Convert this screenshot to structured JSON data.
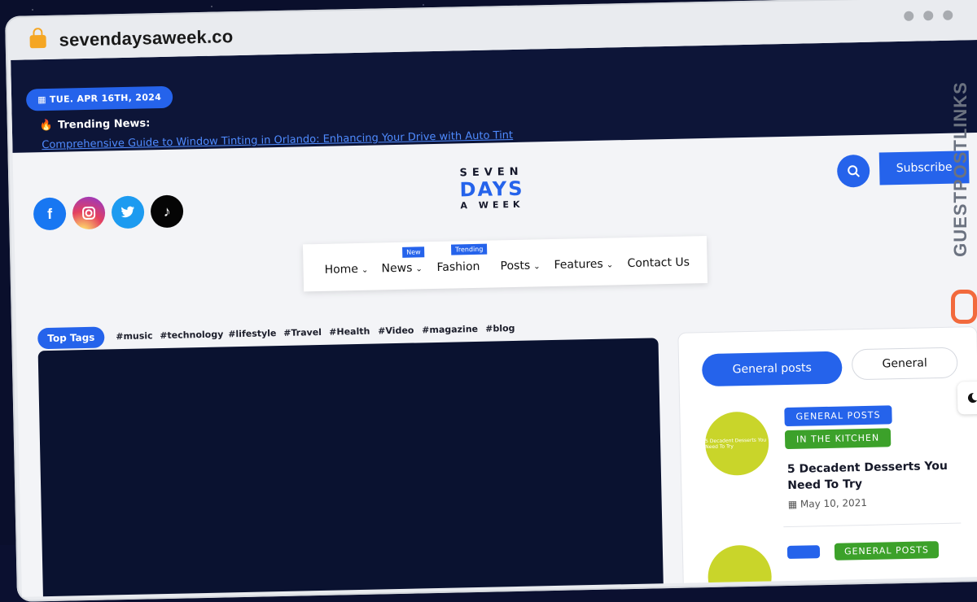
{
  "browser": {
    "url": "sevendaysaweek.co"
  },
  "topbar": {
    "date": "TUE. APR 16TH, 2024",
    "trending_label": "Trending News:",
    "trending_link": "Comprehensive Guide to Window Tinting in Orlando: Enhancing Your Drive with Auto Tint"
  },
  "social": [
    "facebook-icon",
    "instagram-icon",
    "twitter-icon",
    "tiktok-icon"
  ],
  "logo": {
    "line1": "SEVEN",
    "line2": "DAYS",
    "line3": "A WEEK"
  },
  "header": {
    "subscribe": "Subscribe"
  },
  "nav": {
    "items": [
      {
        "label": "Home",
        "chevron": "⌄"
      },
      {
        "label": "News",
        "chevron": "⌄",
        "badge": "New"
      },
      {
        "label": "Fashion",
        "badge": "Trending"
      },
      {
        "label": "Posts",
        "chevron": "⌄"
      },
      {
        "label": "Features",
        "chevron": "⌄"
      },
      {
        "label": "Contact Us"
      }
    ]
  },
  "tags": {
    "label": "Top Tags",
    "items": [
      "#music",
      "#technology",
      "#lifestyle",
      "#Travel",
      "#Health",
      "#Video",
      "#magazine",
      "#blog"
    ]
  },
  "sidebar": {
    "tab_active": "General posts",
    "tab_other": "General",
    "post": {
      "thumb_text": "5 Decadent Desserts You Need To Try",
      "category1": "GENERAL POSTS",
      "category2": "IN THE KITCHEN",
      "title": "5 Decadent Desserts You Need To Try",
      "date": "May 10, 2021"
    },
    "post2": {
      "category2": "GENERAL POSTS"
    }
  },
  "watermark": "GUESTPOSTLINKS",
  "colors": {
    "accent": "#2563eb",
    "topbar": "#0d1538",
    "kitchen": "#3ca12a"
  }
}
